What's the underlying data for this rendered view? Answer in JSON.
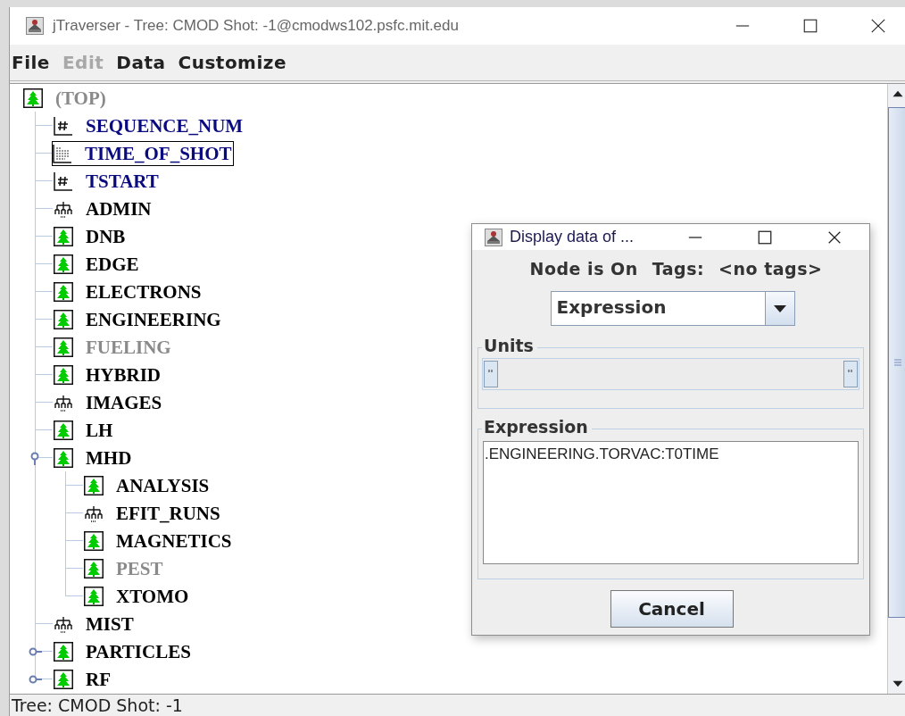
{
  "window": {
    "title": "jTraverser - Tree: CMOD Shot: -1@cmodws102.psfc.mit.edu"
  },
  "menu": [
    {
      "label": "File",
      "disabled": false
    },
    {
      "label": "Edit",
      "disabled": true
    },
    {
      "label": "Data",
      "disabled": false
    },
    {
      "label": "Customize",
      "disabled": false
    }
  ],
  "tree": {
    "label": "(TOP)",
    "kind": "tree",
    "on": false,
    "selected": false,
    "children": [
      {
        "label": "SEQUENCE_NUM",
        "kind": "numeric",
        "on": true,
        "selected": false
      },
      {
        "label": "TIME_OF_SHOT",
        "kind": "signal",
        "on": true,
        "selected": true
      },
      {
        "label": "TSTART",
        "kind": "numeric",
        "on": true,
        "selected": false
      },
      {
        "label": "ADMIN",
        "kind": "structure",
        "on": true,
        "selected": false
      },
      {
        "label": "DNB",
        "kind": "tree",
        "on": true,
        "selected": false
      },
      {
        "label": "EDGE",
        "kind": "tree",
        "on": true,
        "selected": false
      },
      {
        "label": "ELECTRONS",
        "kind": "tree",
        "on": true,
        "selected": false
      },
      {
        "label": "ENGINEERING",
        "kind": "tree",
        "on": true,
        "selected": false
      },
      {
        "label": "FUELING",
        "kind": "tree",
        "on": false,
        "selected": false
      },
      {
        "label": "HYBRID",
        "kind": "tree",
        "on": true,
        "selected": false
      },
      {
        "label": "IMAGES",
        "kind": "structure",
        "on": true,
        "selected": false
      },
      {
        "label": "LH",
        "kind": "tree",
        "on": true,
        "selected": false
      },
      {
        "label": "MHD",
        "kind": "tree",
        "on": true,
        "selected": false,
        "expanded": true,
        "children": [
          {
            "label": "ANALYSIS",
            "kind": "tree",
            "on": true,
            "selected": false
          },
          {
            "label": "EFIT_RUNS",
            "kind": "structure",
            "on": true,
            "selected": false
          },
          {
            "label": "MAGNETICS",
            "kind": "tree",
            "on": true,
            "selected": false
          },
          {
            "label": "PEST",
            "kind": "tree",
            "on": false,
            "selected": false
          },
          {
            "label": "XTOMO",
            "kind": "tree",
            "on": true,
            "selected": false
          }
        ]
      },
      {
        "label": "MIST",
        "kind": "structure",
        "on": true,
        "selected": false
      },
      {
        "label": "PARTICLES",
        "kind": "tree",
        "on": true,
        "selected": false,
        "expanded": false
      },
      {
        "label": "RF",
        "kind": "tree",
        "on": true,
        "selected": false,
        "expanded": false
      }
    ]
  },
  "status_bar": "Tree: CMOD Shot: -1",
  "dialog": {
    "title": "Display data of ...",
    "node_state": "Node is On",
    "tags_label": "Tags:",
    "tags": "<no tags>",
    "type_select": "Expression",
    "units_label": "Units",
    "expression_label": "Expression",
    "expression": ".ENGINEERING.TORVAC:T0TIME",
    "buttons": [
      "Cancel"
    ]
  }
}
